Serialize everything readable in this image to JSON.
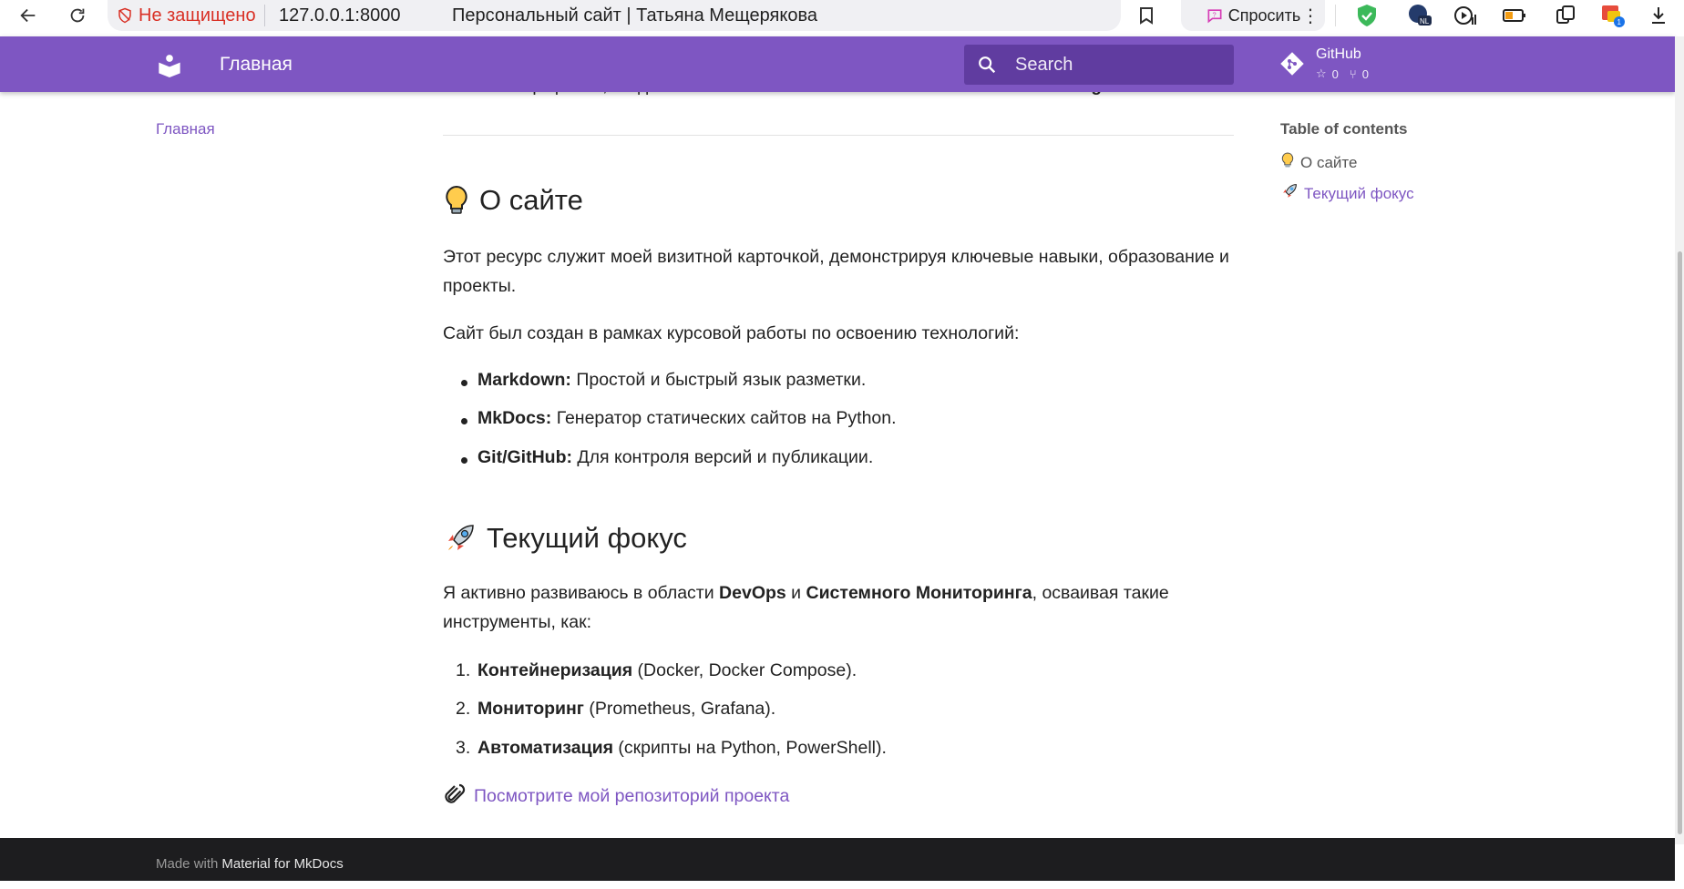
{
  "browser": {
    "not_secure": "Не защищено",
    "url": "127.0.0.1:8000",
    "tab_title": "Персональный сайт | Татьяна Мещерякова",
    "ask_label": "Спросить",
    "ext_badge": "1",
    "ext_nl": "NL"
  },
  "header": {
    "title": "Главная",
    "search_placeholder": "Search",
    "repo_name": "GitHub",
    "repo_stars": "0",
    "repo_forks": "0",
    "accent": "#7e56c2"
  },
  "nav": {
    "home": "Главная"
  },
  "toc": {
    "title": "Table of contents",
    "items": [
      {
        "emoji": "💡",
        "label": "О сайте"
      },
      {
        "emoji": "🚀",
        "label": "Текущий фокус"
      }
    ]
  },
  "content": {
    "intro_a": "Это моё портфолио, созданное с использованием ",
    "intro_b": "MkDocs",
    "intro_c": " и темы ",
    "intro_d": "Material Design",
    "intro_e": ".",
    "about_heading": "О сайте",
    "about_p1": "Этот ресурс служит моей визитной карточкой, демонстрируя ключевые навыки, образование и проекты.",
    "about_p2": "Сайт был создан в рамках курсовой работы по освоению технологий:",
    "tech": [
      {
        "name": "Markdown:",
        "desc": " Простой и быстрый язык разметки."
      },
      {
        "name": "MkDocs:",
        "desc": " Генератор статических сайтов на Python."
      },
      {
        "name": "Git/GitHub:",
        "desc": " Для контроля версий и публикации."
      }
    ],
    "focus_heading": "Текущий фокус",
    "focus_p_a": "Я активно развиваюсь в области ",
    "focus_p_b": "DevOps",
    "focus_p_c": " и ",
    "focus_p_d": "Системного Мониторинга",
    "focus_p_e": ", осваивая такие инструменты, как:",
    "tools": [
      {
        "num": "1.",
        "name": "Контейнеризация",
        "desc": " (Docker, Docker Compose)."
      },
      {
        "num": "2.",
        "name": "Мониторинг",
        "desc": " (Prometheus, Grafana)."
      },
      {
        "num": "3.",
        "name": "Автоматизация",
        "desc": " (скрипты на Python, PowerShell)."
      }
    ],
    "repo_link": "Посмотрите мой репозиторий проекта"
  },
  "footer": {
    "made_with": "Made with",
    "brand": "Material for MkDocs"
  }
}
